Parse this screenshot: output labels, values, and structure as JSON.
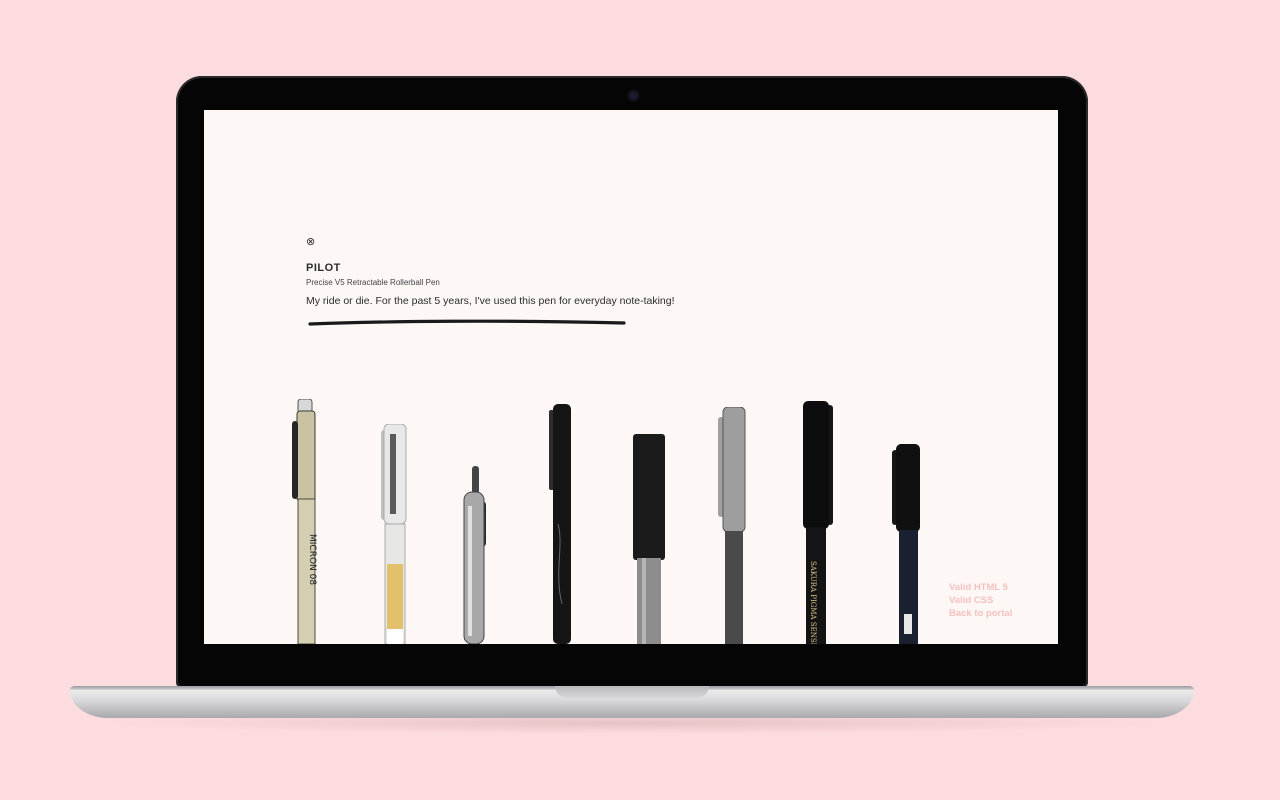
{
  "pen_detail": {
    "close_icon": "⊗",
    "brand": "PILOT",
    "product": "Precise V5 Retractable Rollerball Pen",
    "description": "My ride or die. For the past 5 years, I've used this pen for everyday note-taking!"
  },
  "footer": {
    "links": [
      "Valid HTML 5",
      "Valid CSS",
      "Back to portal"
    ]
  },
  "pen_labels": {
    "micron": "MICRON 08",
    "sakura": "SAKURA  PIGMA SENSEI"
  },
  "colors": {
    "background": "#fddcdf",
    "screen": "#fdf8f6",
    "link": "#f6c0c0"
  }
}
